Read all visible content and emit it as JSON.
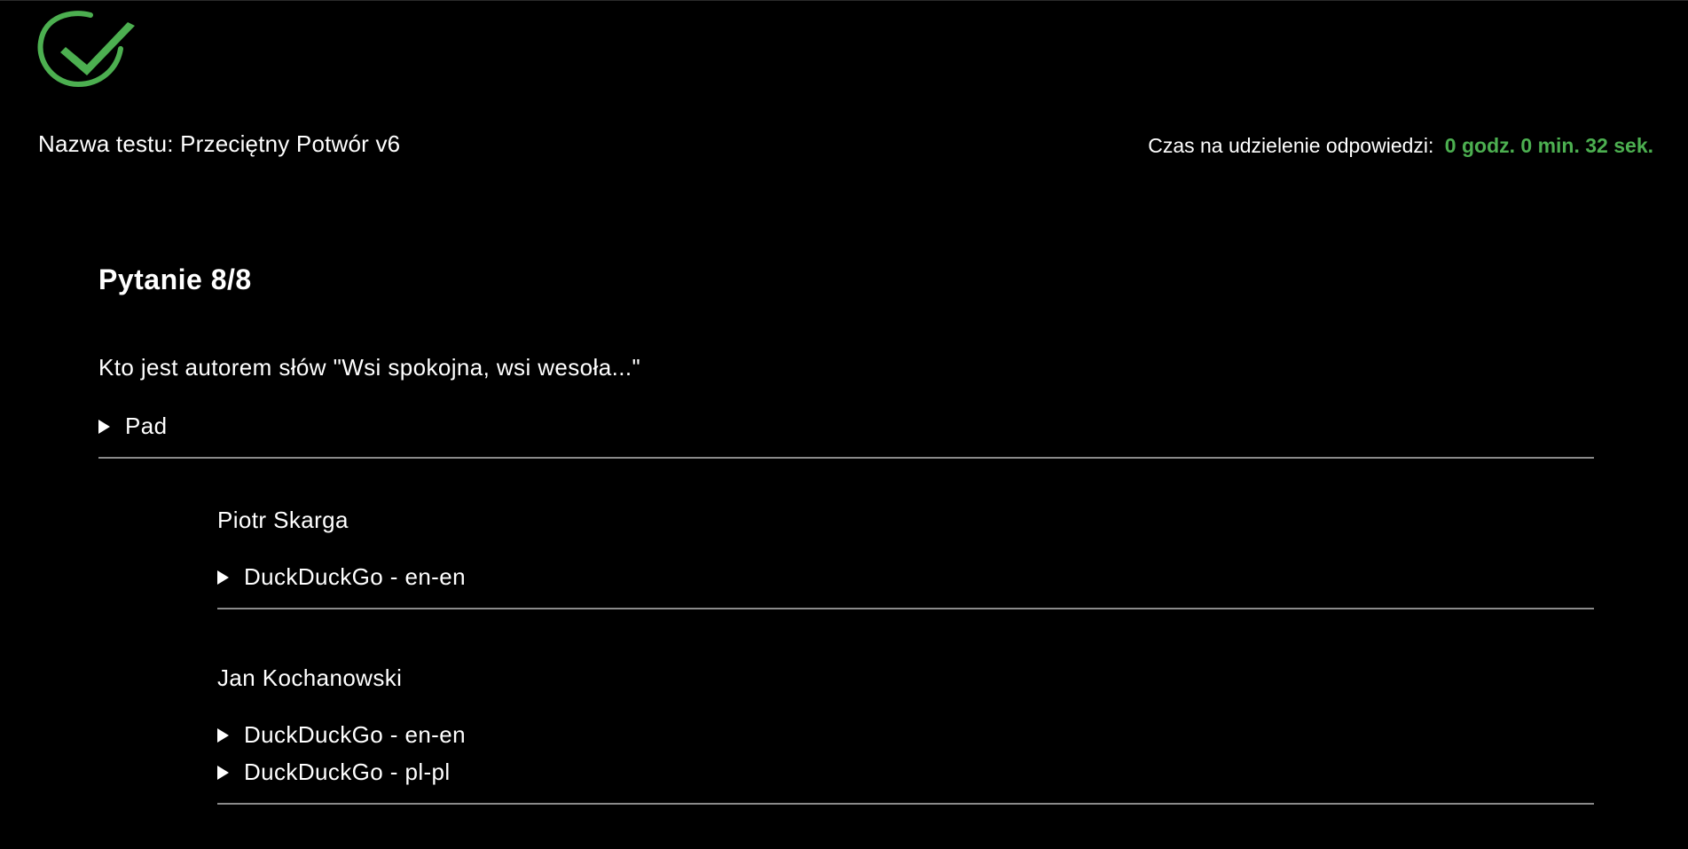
{
  "header": {
    "test_name": "Nazwa testu: Przeciętny Potwór v6",
    "timer_label": "Czas na udzielenie odpowiedzi:",
    "timer_value": "0 godz. 0 min. 32 sek.",
    "logo_icon": "checkmark-circle-icon",
    "accent_color": "#4caf50"
  },
  "question": {
    "title": "Pytanie 8/8",
    "text": "Kto jest autorem słów \"Wsi spokojna, wsi wesoła...\"",
    "details_label": "Pad"
  },
  "answers": [
    {
      "label": "Piotr Skarga",
      "links": [
        "DuckDuckGo - en-en"
      ]
    },
    {
      "label": "Jan Kochanowski",
      "links": [
        "DuckDuckGo - en-en",
        "DuckDuckGo - pl-pl"
      ]
    }
  ]
}
